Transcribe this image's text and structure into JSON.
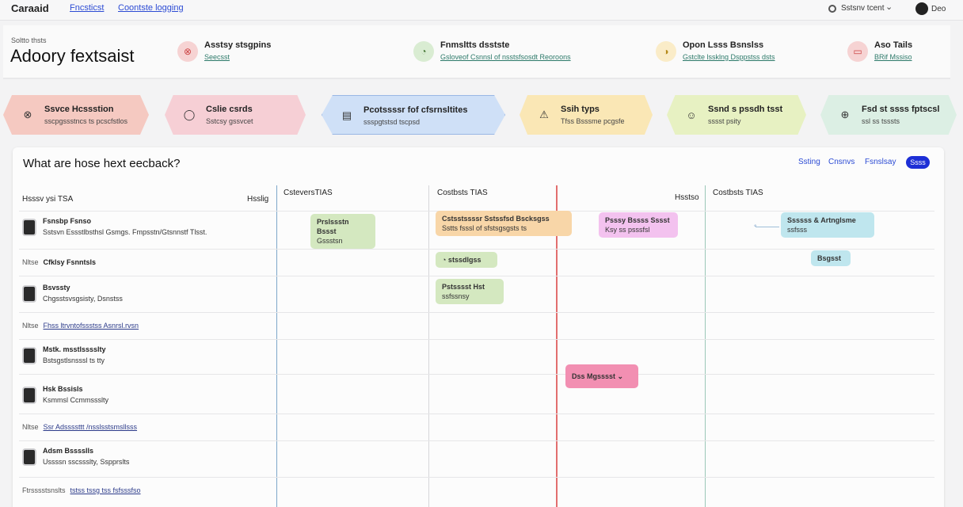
{
  "topbar": {
    "brand": "Caraaid",
    "links": [
      "Fncsticst",
      "Coontste logging"
    ],
    "select_label": "Sstsnv tcent",
    "user_label": "Deo"
  },
  "header": {
    "kicker": "Soltto thsts",
    "title": "Adoory fextsaist",
    "stats": [
      {
        "title": "Asstsy stsgpins",
        "sub": "Seecsst",
        "color": "#f6d3d3",
        "icon": "⊗"
      },
      {
        "title": "Fnmsltts dsstste",
        "sub": "Gsloveof Csnnsl of nsstsfsosdt Reoroons",
        "color": "#d9ecd2",
        "icon": "◔"
      },
      {
        "title": "Opon Lsss Bsnslss",
        "sub": "Gstclte lssklng Dsppstss dsts",
        "color": "#faecc8",
        "icon": "◑"
      },
      {
        "title": "Aso Tails",
        "sub": "BRif Mssiso",
        "color": "#f6d3d3",
        "icon": "▭"
      }
    ]
  },
  "stages": [
    {
      "title": "Ssvce Hcssstion",
      "sub": "sscpgssstncs ts pcscfstlos",
      "color": "#f5c9c1",
      "icon": "⊗"
    },
    {
      "title": "Cslie csrds",
      "sub": "Sstcsy gssvcet",
      "color": "#f6cfd5",
      "icon": "◯"
    },
    {
      "title": "Pcotssssr fof cfsrnsltites",
      "sub": "ssspgtstsd tscpsd",
      "color": "#cfe0f7",
      "icon": "▤"
    },
    {
      "title": "Ssih typs",
      "sub": "Tfss Bsssme pcgsfe",
      "color": "#fae7b5",
      "icon": "⚠"
    },
    {
      "title": "Ssnd s pssdh tsst",
      "sub": "sssst psity",
      "color": "#e7f1c2",
      "icon": "☺"
    },
    {
      "title": "Fsd st ssss fptscsl",
      "sub": "ssl ss tsssts",
      "color": "#dcefe4",
      "icon": "⊕"
    }
  ],
  "board": {
    "question": "What are hose hext eecback?",
    "filters": [
      "Ssting",
      "Cnsnvs",
      "Fsnslsay"
    ],
    "filter_pill": "Ssss",
    "left_header": "Hsssv ysi TSA",
    "left_header_right": "Hsslig",
    "columns": [
      "CsteversTIAS",
      "Costbsts TIAS",
      "Hsstso",
      "Costbsts TIAS"
    ],
    "rows": [
      {
        "name": "Fsnsbp Fsnso",
        "sub": "Sstsvn Essstlbsthsl Gsmgs. Fmpsstn/Gtsnnstf Tlsst.",
        "avatar": true
      },
      {
        "tag": "Nltse",
        "text": "Cfklsy Fsnntsls",
        "avatar": false
      },
      {
        "name": "Bsvssty",
        "sub": "Chgsstsvsgsisty, Dsnstss",
        "avatar": true
      },
      {
        "tag": "Nltse",
        "text": "Fhss ltrvntofssstss Asnrsl.rvsn",
        "avatar": false
      },
      {
        "name": "Mstk. msstlsssslty",
        "sub": "Bstsgstlsnsssl ts tty",
        "avatar": true
      },
      {
        "name": "Hsk Bssisls",
        "sub": "Ksmmsl Ccmmssslty",
        "avatar": true
      },
      {
        "tag": "Nltse",
        "text": "Ssr Adssssttt /nsslsstsmsllsss",
        "avatar": false
      },
      {
        "name": "Adsm Bsssslls",
        "sub": "Ussssn sscssslty, Sspprslts",
        "avatar": true
      },
      {
        "tag": "Ftrsssstsnslts",
        "text": "tstss tssg tss fsfsssfso",
        "avatar": false
      }
    ],
    "cards": [
      {
        "title": "Prslssstn Bssst",
        "sub": "Gssstsn",
        "color": "#d4e8c0"
      },
      {
        "title": "Cstsstssssr Sstssfsd Bscksgss",
        "sub": "Sstts fsssl of sfstsgsgsts ts",
        "color": "#f8d6a8"
      },
      {
        "title": "Psssy Bssss Sssst",
        "sub": "Ksy ss psssfsl",
        "color": "#f3c2ef"
      },
      {
        "title": "Ssssss & Artnglsme",
        "sub": "ssfsss",
        "color": "#bfe6ee"
      },
      {
        "title": "◔ stssdlgss",
        "sub": "",
        "color": "#d4e8c0"
      },
      {
        "title": "Bsgsst",
        "sub": "",
        "color": "#bfe6ee"
      },
      {
        "title": "Pstsssst Hst",
        "sub": "ssfssnsy",
        "color": "#d4e8c0"
      },
      {
        "title": "Dss Mgsssst ⌄",
        "sub": "",
        "color": "#f28fb2"
      }
    ]
  }
}
